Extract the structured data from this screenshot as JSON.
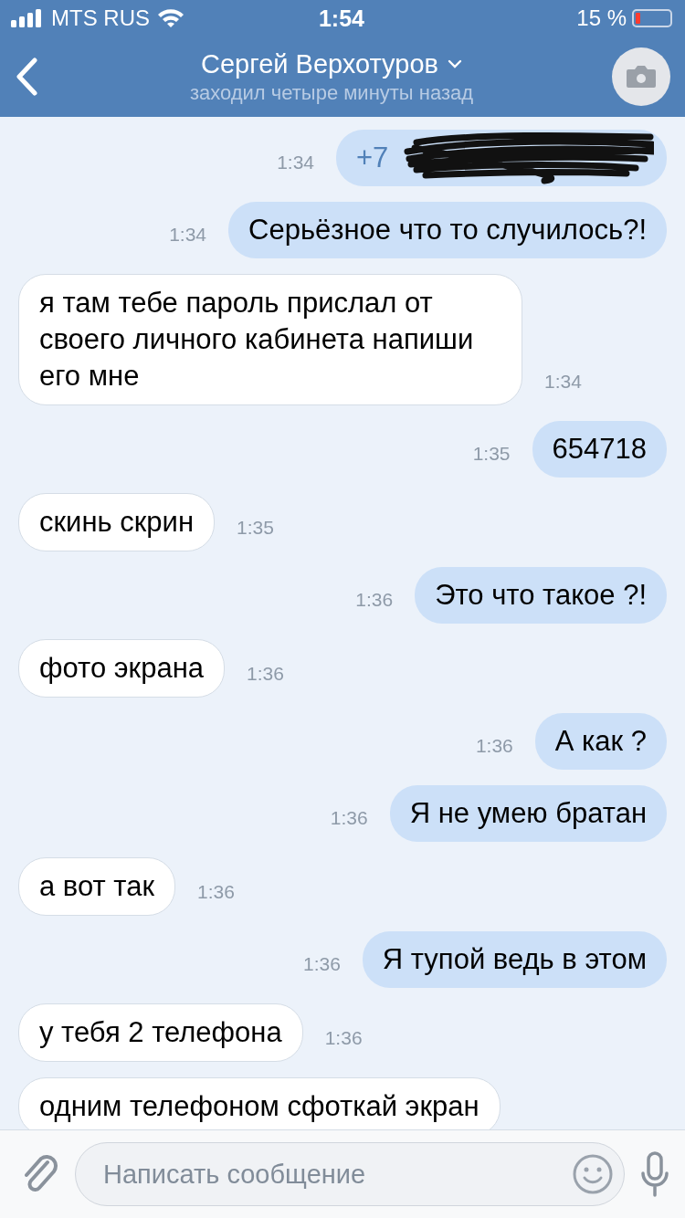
{
  "status_bar": {
    "carrier": "MTS RUS",
    "time": "1:54",
    "battery": "15 %"
  },
  "header": {
    "name": "Сергей Верхотуров",
    "status": "заходил четыре минуты назад"
  },
  "messages": [
    {
      "kind": "outgoing",
      "scribbled": true,
      "text": "+7",
      "time": "1:34"
    },
    {
      "kind": "outgoing",
      "scribbled": false,
      "text": "Серьёзное что то случилось?!",
      "time": "1:34"
    },
    {
      "kind": "incoming",
      "scribbled": false,
      "text": "я там тебе пароль прислал от своего личного кабинета напиши его мне",
      "time": "1:34"
    },
    {
      "kind": "outgoing",
      "scribbled": false,
      "text": "654718",
      "time": "1:35"
    },
    {
      "kind": "incoming",
      "scribbled": false,
      "text": "скинь скрин",
      "time": "1:35"
    },
    {
      "kind": "outgoing",
      "scribbled": false,
      "text": "Это что такое ?!",
      "time": "1:36"
    },
    {
      "kind": "incoming",
      "scribbled": false,
      "text": "фото экрана",
      "time": "1:36"
    },
    {
      "kind": "outgoing",
      "scribbled": false,
      "text": "А как ?",
      "time": "1:36"
    },
    {
      "kind": "outgoing",
      "scribbled": false,
      "text": "Я не умею братан",
      "time": "1:36"
    },
    {
      "kind": "incoming",
      "scribbled": false,
      "text": "а вот так",
      "time": "1:36"
    },
    {
      "kind": "outgoing",
      "scribbled": false,
      "text": "Я тупой ведь в этом",
      "time": "1:36"
    },
    {
      "kind": "incoming",
      "scribbled": false,
      "text": "у тебя 2 телефона",
      "time": "1:36"
    },
    {
      "kind": "incoming",
      "scribbled": false,
      "text": "одним телефоном сфоткай экран"
    }
  ],
  "composer": {
    "placeholder": "Написать сообщение"
  }
}
